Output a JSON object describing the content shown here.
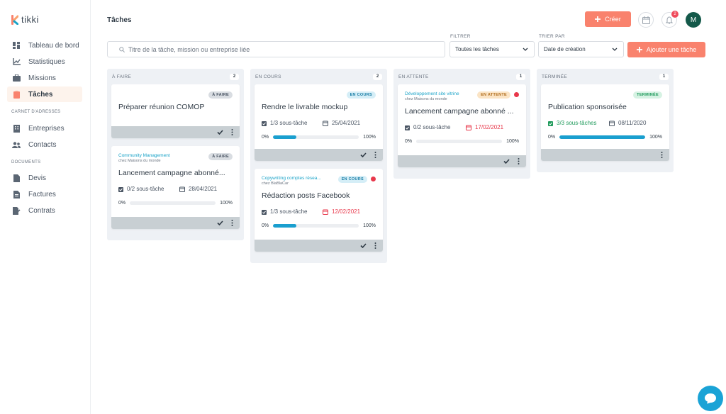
{
  "app": {
    "name": "tikki"
  },
  "colors": {
    "accent": "#f9826d",
    "brand": "#14594a",
    "progress": "#1a9fcf",
    "late": "#e8384b"
  },
  "sidebar": {
    "items": [
      {
        "label": "Tableau de bord",
        "icon": "dashboard-icon"
      },
      {
        "label": "Statistiques",
        "icon": "chart-icon"
      },
      {
        "label": "Missions",
        "icon": "briefcase-icon"
      },
      {
        "label": "Tâches",
        "icon": "clipboard-icon",
        "active": true
      }
    ],
    "section_address": "CARNET D'ADRESSES",
    "address_items": [
      {
        "label": "Entreprises",
        "icon": "building-icon"
      },
      {
        "label": "Contacts",
        "icon": "contacts-icon"
      }
    ],
    "section_docs": "DOCUMENTS",
    "doc_items": [
      {
        "label": "Devis",
        "icon": "document-icon"
      },
      {
        "label": "Factures",
        "icon": "invoice-icon"
      },
      {
        "label": "Contrats",
        "icon": "contract-icon"
      }
    ]
  },
  "header": {
    "title": "Tâches",
    "create_label": "Créer",
    "notifications_count": "2",
    "avatar_initial": "M"
  },
  "toolbar": {
    "search_placeholder": "Titre de la tâche, mission ou entreprise liée",
    "filter_label": "FILTRER",
    "filter_value": "Toutes les tâches",
    "sort_label": "TRIER PAR",
    "sort_value": "Date de création",
    "add_label": "Ajouter une tâche"
  },
  "columns": [
    {
      "title": "À FAIRE",
      "count": "2",
      "cards": [
        {
          "badge": "À FAIRE",
          "title": "Préparer réunion COMOP"
        },
        {
          "badge": "À FAIRE",
          "mission": "Community Management",
          "company": "chez Maisons du monde",
          "title": "Lancement campagne abonné...",
          "subtasks": "0/2 sous-tâche",
          "date": "28/04/2021",
          "progress_start": "0%",
          "progress_end": "100%",
          "progress": 0
        }
      ]
    },
    {
      "title": "EN COURS",
      "count": "2",
      "cards": [
        {
          "badge": "EN COURS",
          "title": "Rendre le livrable mockup",
          "subtasks": "1/3 sous-tâche",
          "date": "25/04/2021",
          "progress_start": "0%",
          "progress_end": "100%",
          "progress": 0.27
        },
        {
          "badge": "EN COURS",
          "mission": "Copywriting comptes résea...",
          "company": "chez BlaBlaCar",
          "title": "Rédaction posts Facebook",
          "subtasks": "1/3 sous-tâche",
          "date": "12/02/2021",
          "progress_start": "0%",
          "progress_end": "100%",
          "progress": 0.27
        }
      ]
    },
    {
      "title": "EN ATTENTE",
      "count": "1",
      "cards": [
        {
          "badge": "EN ATTENTE",
          "mission": "Développement site vitrine",
          "company": "chez Maisons du monde",
          "title": "Lancement campagne abonné ...",
          "subtasks": "0/2 sous-tâche",
          "date": "17/02/2021",
          "progress_start": "0%",
          "progress_end": "100%",
          "progress": 0
        }
      ]
    },
    {
      "title": "TERMINÉE",
      "count": "1",
      "cards": [
        {
          "badge": "TERMINÉE",
          "title": "Publication sponsorisée",
          "subtasks": "3/3 sous-tâches",
          "date": "08/11/2020",
          "progress_start": "0%",
          "progress_end": "100%",
          "progress": 1
        }
      ]
    }
  ]
}
